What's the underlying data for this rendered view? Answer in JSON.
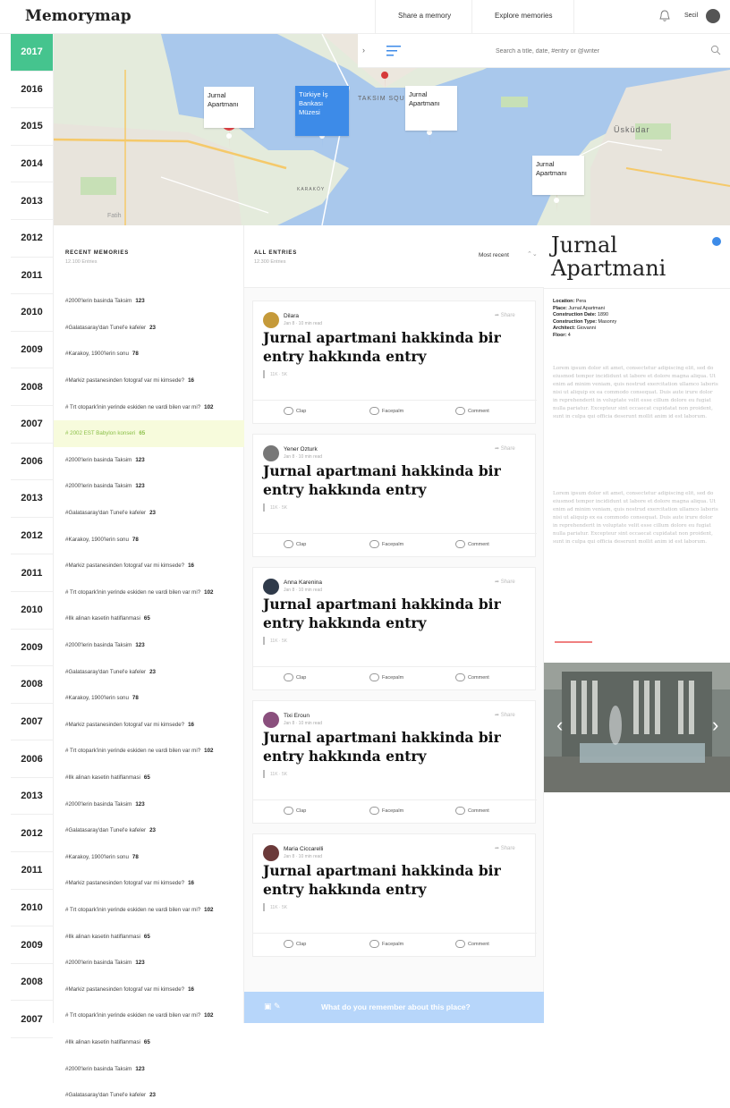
{
  "app": {
    "title": "Memorymap"
  },
  "header": {
    "share_label": "Share a memory",
    "explore_label": "Explore memories",
    "user_name": "Secil"
  },
  "search": {
    "placeholder": "Search a title, date, #entry or @writer"
  },
  "years": [
    "2017",
    "2016",
    "2015",
    "2014",
    "2013",
    "2012",
    "2011",
    "2010",
    "2009",
    "2008",
    "2007",
    "2006",
    "2013",
    "2012",
    "2011",
    "2010",
    "2009",
    "2008",
    "2007",
    "2006",
    "2013",
    "2012",
    "2011",
    "2010",
    "2009",
    "2008",
    "2007"
  ],
  "active_year": "2017",
  "map": {
    "labels": {
      "district1": "TAKSIM SQU",
      "district2": "KARAKÖY",
      "district3": "Fatih",
      "district4": "Üsküdar"
    },
    "pins": [
      {
        "label_line1": "Jurnal",
        "label_line2": "Apartmanı",
        "color": "#e8474b",
        "style": "white"
      },
      {
        "label_line1": "Türkiye İş",
        "label_line2": "Bankası",
        "label_line3": "Müzesi",
        "color": "#3d8be8",
        "style": "blue"
      },
      {
        "label_line1": "Jurnal",
        "label_line2": "Apartmanı",
        "color": "#e8474b",
        "style": "white"
      },
      {
        "label_line1": "Jurnal",
        "label_line2": "Apartmanı",
        "color": "#e8474b",
        "style": "white"
      }
    ]
  },
  "recent": {
    "heading": "RECENT MEMORIES",
    "count": "12.100 Entries",
    "items": [
      {
        "text": "#2000'lerin basinda Taksim",
        "count": "123"
      },
      {
        "text": "#Galatasaray'dan Tunel'e kafeler",
        "count": "23"
      },
      {
        "text": "#Karakoy, 1900'lerin sonu",
        "count": "78"
      },
      {
        "text": "#Markiz pastanesinden fotograf var mi kimsede?",
        "count": "16"
      },
      {
        "text": "# Trt otopark'inin yerinde eskiden ne vardi bilen var mi?",
        "count": "102"
      },
      {
        "text": "# 2002 EST Babylon konseri",
        "count": "65",
        "highlight": true
      },
      {
        "text": "#2000'lerin basinda Taksim",
        "count": "123"
      },
      {
        "text": "#2000'lerin basinda Taksim",
        "count": "123"
      },
      {
        "text": "#Galatasaray'dan Tunel'e kafeler",
        "count": "23"
      },
      {
        "text": "#Karakoy, 1900'lerin sonu",
        "count": "78"
      },
      {
        "text": "#Markiz pastanesinden fotograf var mi kimsede?",
        "count": "16"
      },
      {
        "text": "# Trt otopark'inin yerinde eskiden ne vardi bilen var mi?",
        "count": "102"
      },
      {
        "text": "#Ilk alinan kasetin hatiflanmasi",
        "count": "65"
      },
      {
        "text": "#2000'lerin basinda Taksim",
        "count": "123"
      },
      {
        "text": "#Galatasaray'dan Tunel'e kafeler",
        "count": "23"
      },
      {
        "text": "#Karakoy, 1900'lerin sonu",
        "count": "78"
      },
      {
        "text": "#Markiz pastanesinden fotograf var mi kimsede?",
        "count": "16"
      },
      {
        "text": "# Trt otopark'inin yerinde eskiden ne vardi bilen var mi?",
        "count": "102"
      },
      {
        "text": "#Ilk alinan kasetin hatiflanmasi",
        "count": "65"
      },
      {
        "text": "#2000'lerin basinda Taksim",
        "count": "123"
      },
      {
        "text": "#Galatasaray'dan Tunel'e kafeler",
        "count": "23"
      },
      {
        "text": "#Karakoy, 1900'lerin sonu",
        "count": "78"
      },
      {
        "text": "#Markiz pastanesinden fotograf var mi kimsede?",
        "count": "16"
      },
      {
        "text": "# Trt otopark'inin yerinde eskiden ne vardi bilen var mi?",
        "count": "102"
      },
      {
        "text": "#Ilk alinan kasetin hatiflanmasi",
        "count": "65"
      },
      {
        "text": "#2000'lerin basinda Taksim",
        "count": "123"
      },
      {
        "text": "#Markiz pastanesinden fotograf var mi kimsede?",
        "count": "16"
      },
      {
        "text": "# Trt otopark'inin yerinde eskiden ne vardi bilen var mi?",
        "count": "102"
      },
      {
        "text": "#Ilk alinan kasetin hatiflanmasi",
        "count": "65"
      },
      {
        "text": "#2000'lerin basinda Taksim",
        "count": "123"
      },
      {
        "text": "#Galatasaray'dan Tunel'e kafeler",
        "count": "23"
      }
    ]
  },
  "entries": {
    "heading": "ALL ENTRIES",
    "count": "12.300 Entries",
    "sort_label": "Most recent",
    "items": [
      {
        "author": "Dilara",
        "date": "Jan 8 · 10 min read",
        "title": "Jurnal apartmani hakkinda bir entry hakkında entry",
        "stats": "11K · 5K",
        "avatar_color": "#c59a3a"
      },
      {
        "author": "Yener Ozturk",
        "date": "Jan 8 · 10 min read",
        "title": "Jurnal apartmani hakkinda bir entry hakkında entry",
        "stats": "11K · 5K",
        "avatar_color": "#777777"
      },
      {
        "author": "Anna Karenina",
        "date": "Jan 8 · 10 min read",
        "title": "Jurnal apartmani hakkinda bir entry hakkında entry",
        "stats": "11K · 5K",
        "avatar_color": "#2f3a4a"
      },
      {
        "author": "Tixi Eroun",
        "date": "Jan 8 · 10 min read",
        "title": "Jurnal apartmani hakkinda bir entry hakkında entry",
        "stats": "11K · 5K",
        "avatar_color": "#8a4f7d"
      },
      {
        "author": "Maria Ciccarelli",
        "date": "Jan 8 · 10 min read",
        "title": "Jurnal apartmani hakkinda bir entry hakkında entry",
        "stats": "11K · 5K",
        "avatar_color": "#6b3a3a"
      }
    ],
    "share_label": "Share",
    "clap_label": "Clap",
    "facepalm_label": "Facepalm",
    "comment_label": "Comment"
  },
  "compose": {
    "placeholder": "What do you remember about this place?"
  },
  "detail": {
    "title": "Jurnal Apartmani",
    "info": [
      {
        "key": "Location:",
        "value": "Pera"
      },
      {
        "key": "Place:",
        "value": "Jurnal Apartmani"
      },
      {
        "key": "Construction Date:",
        "value": "1890"
      },
      {
        "key": "Construction Type:",
        "value": "Masonry"
      },
      {
        "key": "Architect:",
        "value": "Giovanni"
      },
      {
        "key": "Floor:",
        "value": "4"
      }
    ],
    "paragraph1": "Lorem ipsum dolor sit amet, consectetur adipiscing elit, sed do eiusmod tempor incididunt ut labore et dolore magna aliqua. Ut enim ad minim veniam, quis nostrud exercitation ullamco laboris nisi ut aliquip ex ea commodo consequat. Duis aute irure dolor in reprehenderit in voluptate velit esse cillum dolore eu fugiat nulla pariatur. Excepteur sint occaecat cupidatat non proident, sunt in culpa qui officia deserunt mollit anim id est laborum.",
    "paragraph2": "Lorem ipsum dolor sit amet, consectetur adipiscing elit, sed do eiusmod tempor incididunt ut labore et dolore magna aliqua. Ut enim ad minim veniam, quis nostrud exercitation ullamco laboris nisi ut aliquip ex ea commodo consequat. Duis aute irure dolor in reprehenderit in voluptate velit esse cillum dolore eu fugiat nulla pariatur. Excepteur sint occaecat cupidatat non proident, sunt in culpa qui officia deserunt mollit anim id est laborum."
  },
  "colors": {
    "accent_green": "#45c48e",
    "pin_red": "#e8474b",
    "accent_blue": "#3d8be8",
    "water": "#a9c8ec"
  }
}
